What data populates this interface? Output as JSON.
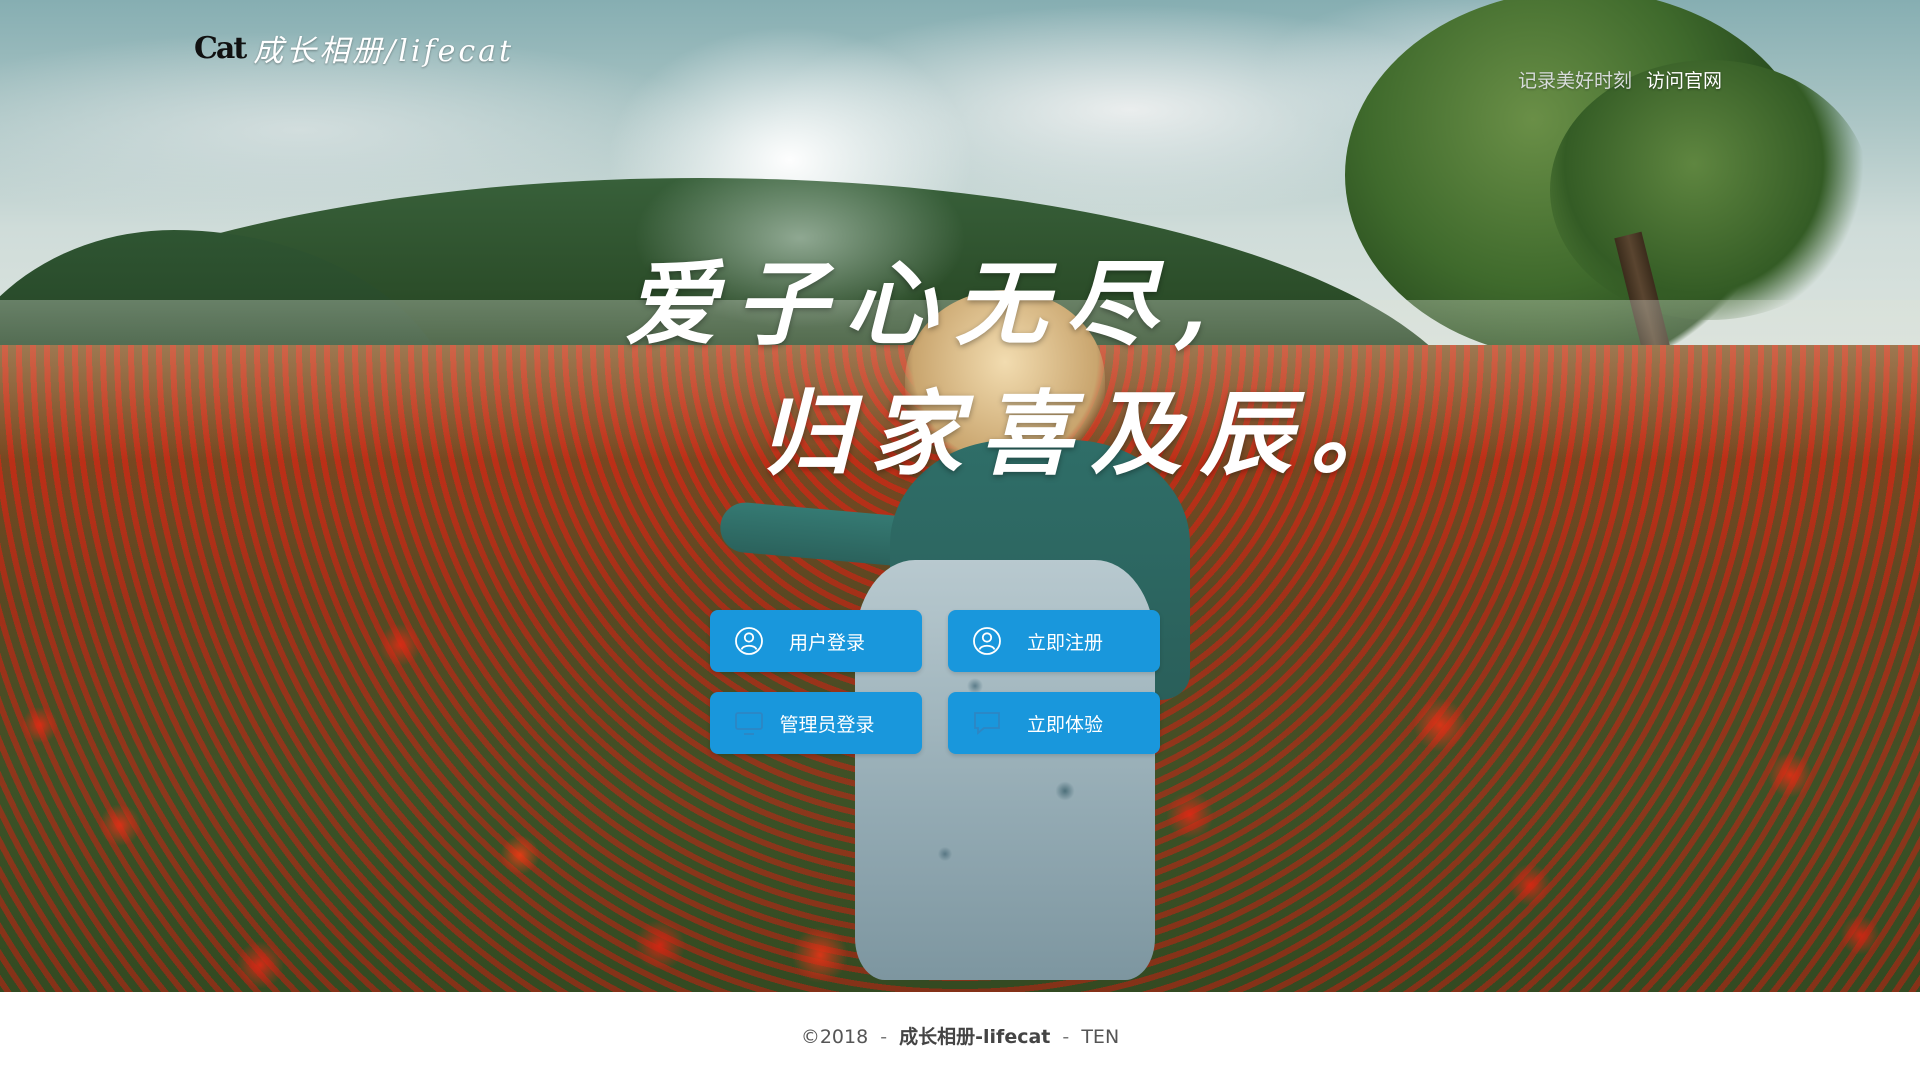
{
  "header": {
    "logo_mark": "Cat",
    "logo_text": "成长相册/lifecat",
    "tagline": "记录美好时刻",
    "site_link": "访问官网"
  },
  "hero": {
    "poem_line1": "爱子心无尽,",
    "poem_line2": "归家喜及辰。"
  },
  "actions": {
    "user_login": "用户登录",
    "register": "立即注册",
    "admin_login": "管理员登录",
    "try_now": "立即体验"
  },
  "footer": {
    "copyright": "©2018",
    "sep1": "-",
    "site_name": "成长相册-lifecat",
    "sep2": "-",
    "author": "TEN"
  },
  "colors": {
    "button_bg": "#1997dc",
    "footer_bg": "#ffffff"
  }
}
